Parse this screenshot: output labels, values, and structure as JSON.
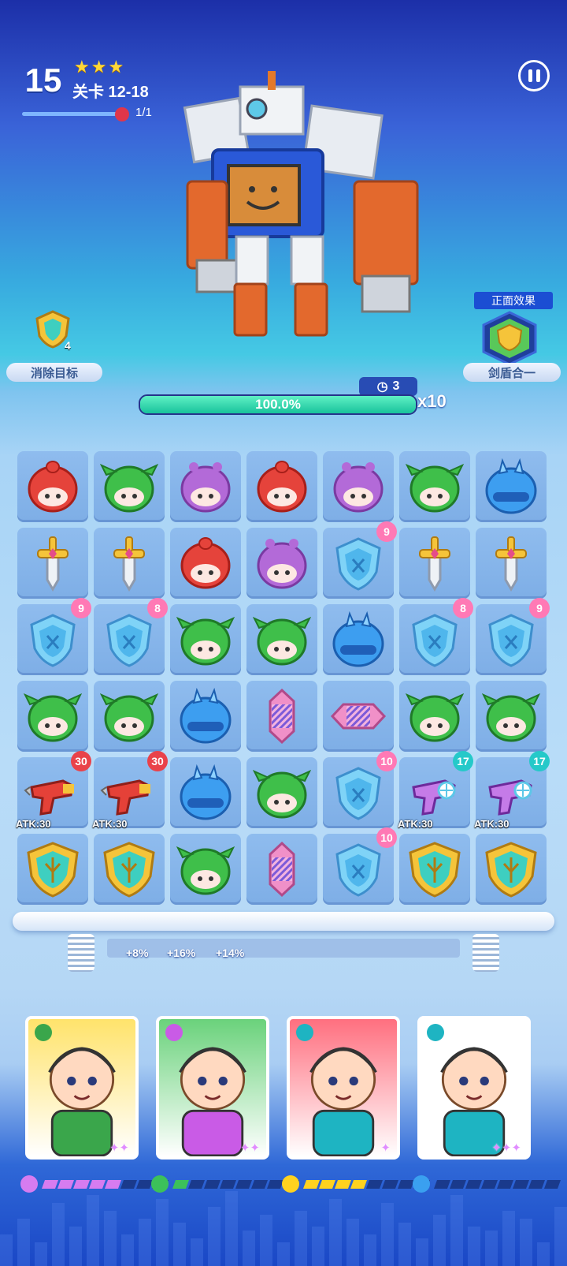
{
  "hud": {
    "level_number": "15",
    "stars": "★★★",
    "stage_label": "关卡 12-18",
    "stage_progress": 1.0,
    "enemy_count": "1/1"
  },
  "boss": {
    "hp_percent_label": "100.0%",
    "hp_fraction": 1.0,
    "turns_left": "3",
    "multiplier": "x10"
  },
  "left_objective": {
    "label": "消除目标",
    "count": "4"
  },
  "right_effect": {
    "title": "正面效果",
    "label": "剑盾合一"
  },
  "grid": [
    [
      {
        "t": "red"
      },
      {
        "t": "green"
      },
      {
        "t": "purple"
      },
      {
        "t": "red"
      },
      {
        "t": "purple"
      },
      {
        "t": "green"
      },
      {
        "t": "blue"
      }
    ],
    [
      {
        "t": "sword"
      },
      {
        "t": "sword"
      },
      {
        "t": "red"
      },
      {
        "t": "purple"
      },
      {
        "t": "shield",
        "badge": "9"
      },
      {
        "t": "sword"
      },
      {
        "t": "sword"
      }
    ],
    [
      {
        "t": "shield",
        "badge": "9"
      },
      {
        "t": "shield",
        "badge": "8"
      },
      {
        "t": "green"
      },
      {
        "t": "green"
      },
      {
        "t": "blue"
      },
      {
        "t": "shield",
        "badge": "8"
      },
      {
        "t": "shield",
        "badge": "9"
      }
    ],
    [
      {
        "t": "green"
      },
      {
        "t": "green"
      },
      {
        "t": "blue"
      },
      {
        "t": "vrocket"
      },
      {
        "t": "hrocket"
      },
      {
        "t": "green"
      },
      {
        "t": "green"
      }
    ],
    [
      {
        "t": "redgun",
        "badge": "30",
        "atk": "ATK:30"
      },
      {
        "t": "redgun",
        "badge": "30",
        "atk": "ATK:30"
      },
      {
        "t": "blue"
      },
      {
        "t": "green"
      },
      {
        "t": "shield",
        "badge": "10"
      },
      {
        "t": "icegun",
        "badge": "17",
        "atk": "ATK:30"
      },
      {
        "t": "icegun",
        "badge": "17",
        "atk": "ATK:30"
      }
    ],
    [
      {
        "t": "goldshield"
      },
      {
        "t": "goldshield"
      },
      {
        "t": "green"
      },
      {
        "t": "vrocket"
      },
      {
        "t": "shield",
        "badge": "10"
      },
      {
        "t": "goldshield"
      },
      {
        "t": "goldshield"
      }
    ]
  ],
  "bonuses": [
    "+8%",
    "+16%",
    "+14%"
  ],
  "heroes": [
    {
      "name": "opera-warrior",
      "stars": "✦✦",
      "element_color": "#3aa64b",
      "bg": "#ffe36b",
      "energy_color": "#d77cf0",
      "energy_filled": 5,
      "energy_total": 8
    },
    {
      "name": "tribal-girl",
      "stars": "✦✦",
      "element_color": "#c95be6",
      "bg": "#6ad27b",
      "energy_color": "#3cc15a",
      "energy_filled": 1,
      "energy_total": 8
    },
    {
      "name": "blue-hood-boy",
      "stars": "✦",
      "element_color": "#1eb4c2",
      "bg": "#ff6f7f",
      "energy_color": "#ffd21f",
      "energy_filled": 4,
      "energy_total": 8
    },
    {
      "name": "helmet-bunny",
      "stars": "✦✦✦",
      "element_color": "#1eb4c2",
      "bg": "#ffffff",
      "energy_color": "#3aa0f0",
      "energy_filled": 0,
      "energy_total": 8
    }
  ],
  "colors": {
    "accent_blue": "#1b4ed3",
    "hp_green": "#18c39b",
    "badge_pink": "#ff79b5"
  }
}
